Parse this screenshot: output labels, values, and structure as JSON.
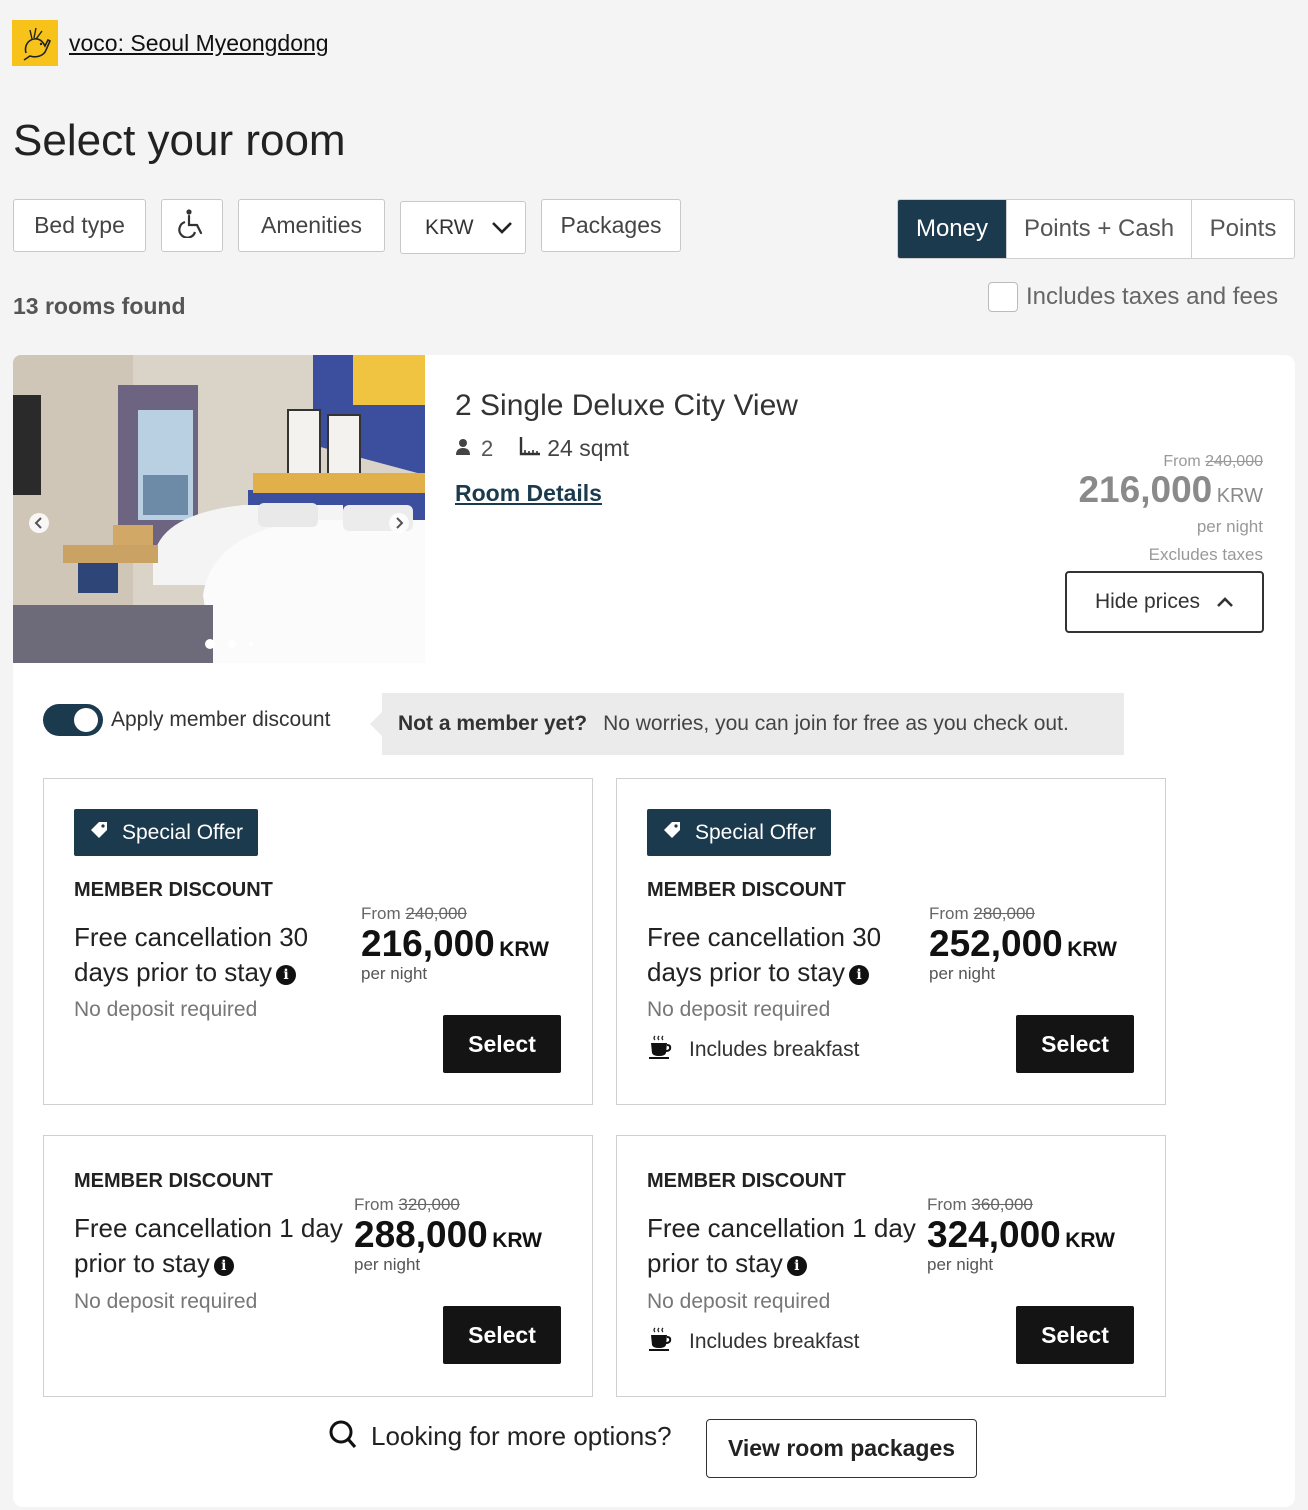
{
  "brand": {
    "hotel_name": "voco: Seoul Myeongdong"
  },
  "page": {
    "title": "Select your room"
  },
  "filters": {
    "bed_type": "Bed type",
    "accessibility_icon": "wheelchair-icon",
    "amenities": "Amenities",
    "currency": "KRW",
    "packages": "Packages"
  },
  "payment_toggle": {
    "options": [
      "Money",
      "Points + Cash",
      "Points"
    ],
    "selected": "Money"
  },
  "results": {
    "count_text": "13 rooms found"
  },
  "taxes": {
    "label": "Includes taxes and fees",
    "checked": false
  },
  "room": {
    "name": "2 Single Deluxe City View",
    "guests": "2",
    "size": "24 sqmt",
    "details_link": "Room Details",
    "from_label": "From",
    "original_price": "240,000",
    "price": "216,000",
    "currency": "KRW",
    "per_night": "per night",
    "tax_note": "Excludes taxes",
    "hide_prices": "Hide prices",
    "carousel": {
      "slides": 3,
      "active": 0
    }
  },
  "member": {
    "toggle_label": "Apply member discount",
    "toggle_on": true,
    "bubble_bold": "Not a member yet?",
    "bubble_text": "No worries, you can join for free as you check out."
  },
  "offers": [
    {
      "badge": "Special Offer",
      "heading": "MEMBER DISCOUNT",
      "description": "Free cancellation 30 days prior to stay",
      "deposit": "No deposit required",
      "from": "From",
      "original": "240,000",
      "price": "216,000",
      "currency": "KRW",
      "per_night": "per night",
      "select": "Select"
    },
    {
      "badge": "Special Offer",
      "heading": "MEMBER DISCOUNT",
      "description": "Free cancellation 30 days prior to stay",
      "deposit": "No deposit required",
      "breakfast": "Includes breakfast",
      "from": "From",
      "original": "280,000",
      "price": "252,000",
      "currency": "KRW",
      "per_night": "per night",
      "select": "Select"
    },
    {
      "heading": "MEMBER DISCOUNT",
      "description": "Free cancellation 1 day prior to stay",
      "deposit": "No deposit required",
      "from": "From",
      "original": "320,000",
      "price": "288,000",
      "currency": "KRW",
      "per_night": "per night",
      "select": "Select"
    },
    {
      "heading": "MEMBER DISCOUNT",
      "description": "Free cancellation 1 day prior to stay",
      "deposit": "No deposit required",
      "breakfast": "Includes breakfast",
      "from": "From",
      "original": "360,000",
      "price": "324,000",
      "currency": "KRW",
      "per_night": "per night",
      "select": "Select"
    }
  ],
  "more": {
    "text": "Looking for more options?",
    "button": "View room packages"
  },
  "colors": {
    "accent": "#1b3a4e",
    "logo": "#f7c21a",
    "button": "#141414",
    "background": "#f4f4f4"
  }
}
